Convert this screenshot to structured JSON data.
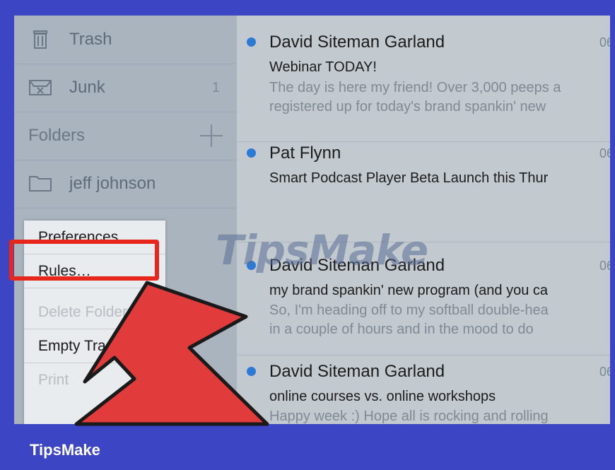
{
  "sidebar": {
    "trash_label": "Trash",
    "junk_label": "Junk",
    "junk_count": "1",
    "folders_label": "Folders",
    "folder_item": "jeff johnson"
  },
  "menu": {
    "items": [
      {
        "label": "Preferences…",
        "enabled": true
      },
      {
        "label": "Rules…",
        "enabled": true
      },
      {
        "label": "Delete Folder",
        "enabled": false
      },
      {
        "label": "Empty Trash",
        "enabled": true
      },
      {
        "label": "Print",
        "enabled": false
      }
    ]
  },
  "messages": [
    {
      "sender": "David Siteman Garland",
      "date": "06/",
      "subject": "Webinar TODAY!",
      "preview": [
        "The day is here my friend! Over 3,000 peeps a",
        "registered up for today's brand spankin' new"
      ]
    },
    {
      "sender": "Pat Flynn",
      "date": "06/",
      "subject": "Smart Podcast Player Beta Launch this Thur",
      "preview": []
    },
    {
      "sender": "David Siteman Garland",
      "date": "06/",
      "subject": "my brand spankin' new program (and you ca",
      "preview": [
        "So, I'm heading off to my softball double-hea",
        "in a couple of hours and in the mood to do"
      ]
    },
    {
      "sender": "David Siteman Garland",
      "date": "06/",
      "subject": "online courses vs. online workshops",
      "preview": [
        "Happy week :) Hope all is rocking and rolling"
      ]
    }
  ],
  "watermark": "TipsMake",
  "brand": "TipsMake",
  "colors": {
    "accent_frame": "#3c46c4",
    "unread_dot": "#2c79d6",
    "highlight": "#e8261b",
    "arrow": "#e23b3b"
  },
  "icons": [
    "trash-icon",
    "junk-icon",
    "plus-icon",
    "folder-icon",
    "pointer-arrow-icon"
  ]
}
